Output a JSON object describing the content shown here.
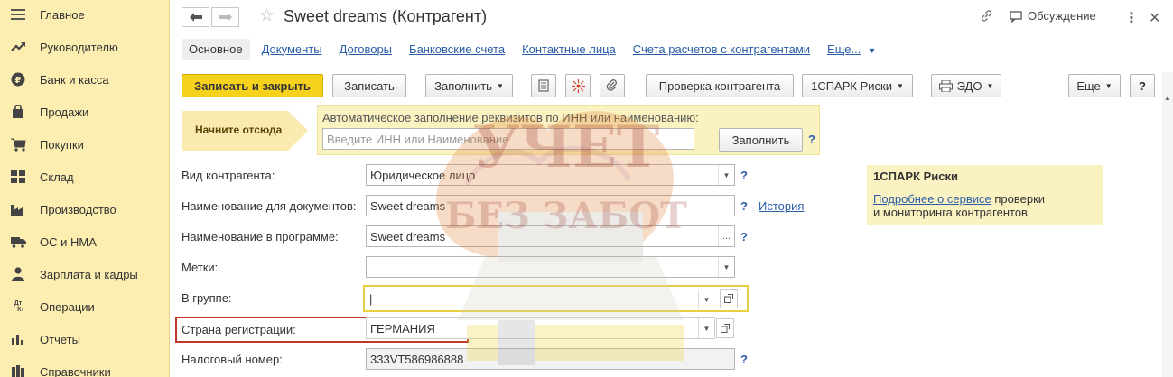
{
  "sidebar": {
    "items": [
      {
        "label": "Главное",
        "icon": "menu-icon"
      },
      {
        "label": "Руководителю",
        "icon": "trend-icon"
      },
      {
        "label": "Банк и касса",
        "icon": "coin-icon"
      },
      {
        "label": "Продажи",
        "icon": "bag-icon"
      },
      {
        "label": "Покупки",
        "icon": "cart-icon"
      },
      {
        "label": "Склад",
        "icon": "warehouse-icon"
      },
      {
        "label": "Производство",
        "icon": "factory-icon"
      },
      {
        "label": "ОС и НМА",
        "icon": "truck-icon"
      },
      {
        "label": "Зарплата и кадры",
        "icon": "person-icon"
      },
      {
        "label": "Операции",
        "icon": "dt-kt-icon"
      },
      {
        "label": "Отчеты",
        "icon": "bar-chart-icon"
      },
      {
        "label": "Справочники",
        "icon": "book-icon"
      }
    ],
    "dtkt_top": "Дт",
    "dtkt_bottom": "Кт"
  },
  "header": {
    "title": "Sweet dreams (Контрагент)",
    "discussion": "Обсуждение"
  },
  "tabs": [
    "Основное",
    "Документы",
    "Договоры",
    "Банковские счета",
    "Контактные лица",
    "Счета расчетов с контрагентами",
    "Еще..."
  ],
  "toolbar": {
    "save_close": "Записать и закрыть",
    "save": "Записать",
    "fill": "Заполнить",
    "check": "Проверка контрагента",
    "spark": "1СПАРК Риски",
    "edo": "ЭДО",
    "more": "Еще",
    "help": "?"
  },
  "start": {
    "label": "Начните отсюда",
    "title": "Автоматическое заполнение реквизитов по ИНН или наименованию:",
    "placeholder": "Введите ИНН или Наименование",
    "fill_button": "Заполнить"
  },
  "fields": {
    "type_label": "Вид контрагента:",
    "type_value": "Юридическое лицо",
    "docname_label": "Наименование для документов:",
    "docname_value": "Sweet dreams",
    "history_link": "История",
    "progname_label": "Наименование в программе:",
    "progname_value": "Sweet dreams",
    "tags_label": "Метки:",
    "tags_value": "",
    "group_label": "В группе:",
    "group_value": "|",
    "country_label": "Страна регистрации:",
    "country_value": "ГЕРМАНИЯ",
    "tax_label": "Налоговый номер:",
    "tax_value": "333VT586986888",
    "ellipsis": "...",
    "question": "?"
  },
  "spark_panel": {
    "title": "1СПАРК Риски",
    "link": "Подробнее о сервисе",
    "text_after_link": " проверки",
    "text_line2": "и мониторинга контрагентов"
  },
  "watermark": {
    "line1": "УЧЕТ",
    "line2": "БЕЗ ЗАБОТ"
  },
  "colors": {
    "sidebar_bg": "#fbeeb0",
    "primary_button": "#f6d21c",
    "link": "#2a5da8",
    "highlight_border_red": "#c0392b",
    "highlight_border_yellow": "#e8cf3f"
  }
}
